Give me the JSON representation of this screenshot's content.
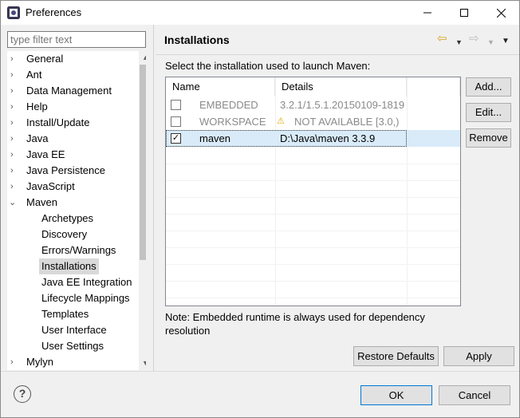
{
  "window": {
    "title": "Preferences",
    "minimize_icon": "minimize-icon",
    "maximize_icon": "maximize-icon",
    "close_icon": "close-icon"
  },
  "filter": {
    "placeholder": "type filter text"
  },
  "tree": {
    "items": [
      {
        "label": "General",
        "expander": "chevron-right"
      },
      {
        "label": "Ant",
        "expander": "chevron-right"
      },
      {
        "label": "Data Management",
        "expander": "chevron-right"
      },
      {
        "label": "Help",
        "expander": "chevron-right"
      },
      {
        "label": "Install/Update",
        "expander": "chevron-right"
      },
      {
        "label": "Java",
        "expander": "chevron-right"
      },
      {
        "label": "Java EE",
        "expander": "chevron-right"
      },
      {
        "label": "Java Persistence",
        "expander": "chevron-right"
      },
      {
        "label": "JavaScript",
        "expander": "chevron-right"
      },
      {
        "label": "Maven",
        "expander": "chevron-down"
      },
      {
        "label": "Archetypes"
      },
      {
        "label": "Discovery"
      },
      {
        "label": "Errors/Warnings"
      },
      {
        "label": "Installations",
        "selected": true
      },
      {
        "label": "Java EE Integration"
      },
      {
        "label": "Lifecycle Mappings"
      },
      {
        "label": "Templates"
      },
      {
        "label": "User Interface"
      },
      {
        "label": "User Settings"
      },
      {
        "label": "Mylyn",
        "expander": "chevron-right"
      }
    ]
  },
  "page": {
    "title": "Installations",
    "select_label": "Select the installation used to launch Maven:",
    "table": {
      "columns": [
        "Name",
        "Details"
      ],
      "rows": [
        {
          "checked": false,
          "name": "EMBEDDED",
          "details": "3.2.1/1.5.1.20150109-1819",
          "disabled": true
        },
        {
          "checked": false,
          "name": "WORKSPACE",
          "details": "NOT AVAILABLE [3.0,)",
          "disabled": true,
          "warning": true
        },
        {
          "checked": true,
          "name": "maven",
          "details": "D:\\Java\\maven 3.3.9",
          "selected": true
        }
      ]
    },
    "buttons": {
      "add": "Add...",
      "edit": "Edit...",
      "remove": "Remove"
    },
    "note_line1": "Note: Embedded runtime is always used for dependency",
    "note_line2": "resolution",
    "restore_defaults": "Restore Defaults",
    "apply": "Apply"
  },
  "footer": {
    "ok": "OK",
    "cancel": "Cancel"
  },
  "colors": {
    "selection_row": "#d9ebf9",
    "tree_selection": "#d9d9d9",
    "ok_border": "#0078d7",
    "back_arrow": "#d9a21f"
  }
}
